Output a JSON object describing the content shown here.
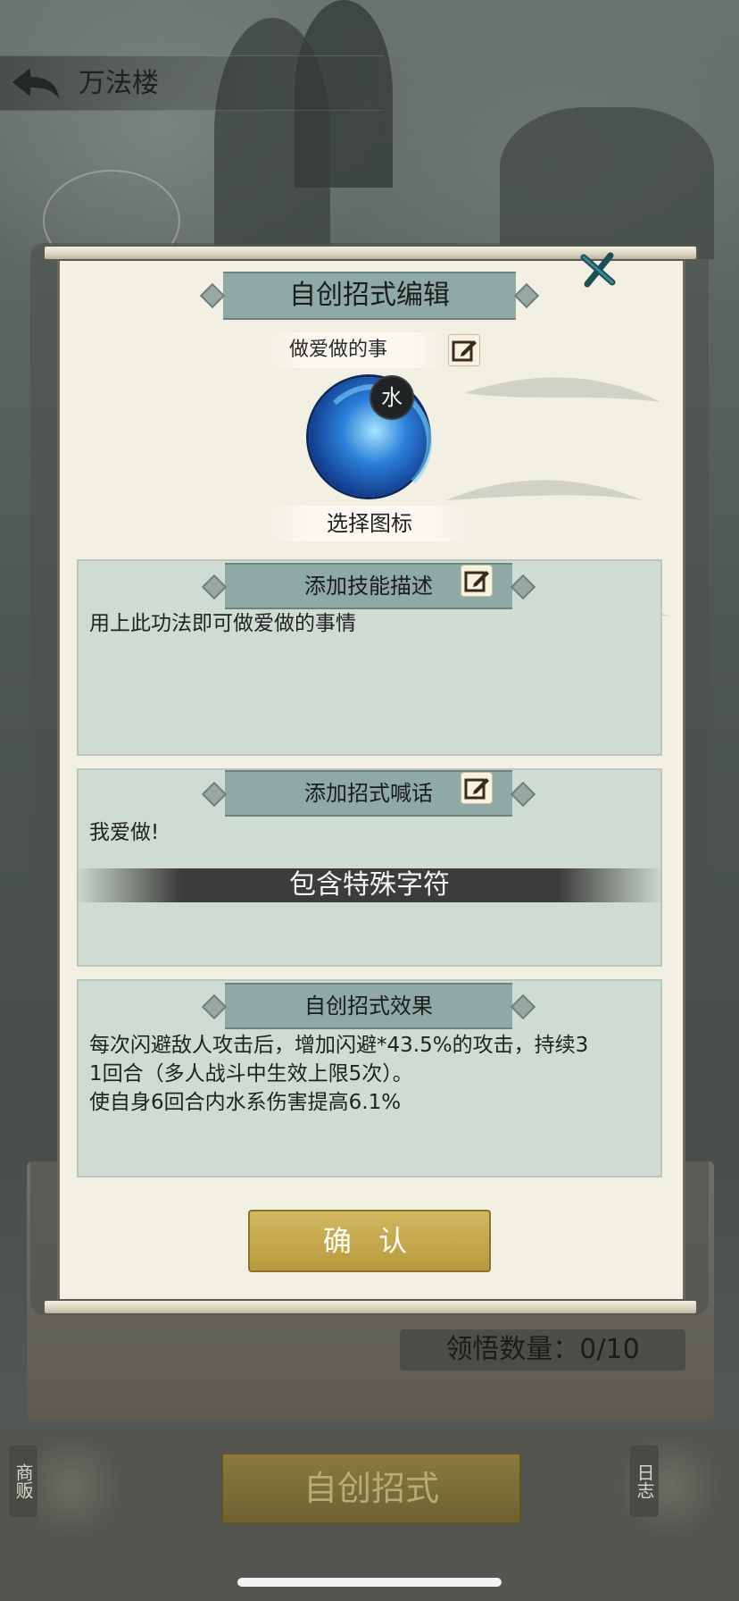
{
  "header": {
    "title": "万法楼"
  },
  "modal": {
    "title": "自创招式编辑",
    "skill_name": "做爱做的事",
    "element_badge": "水",
    "select_icon_label": "选择图标",
    "description": {
      "header": "添加技能描述",
      "text": "用上此功法即可做爱做的事情"
    },
    "shout": {
      "header": "添加招式喊话",
      "text": "我爱做!"
    },
    "toast": "包含特殊字符",
    "effect": {
      "header": "自创招式效果",
      "line1": "每次闪避敌人攻击后，增加闪避*43.5%的攻击，持续3",
      "line2": "1回合（多人战斗中生效上限5次）。",
      "line3": "使自身6回合内水系伤害提高6.1%"
    },
    "confirm_label": "确 认"
  },
  "background": {
    "comprehension_label": "领悟数量：0/10",
    "create_button_label": "自创招式",
    "left_side_label": "商贩",
    "right_side_label": "日志"
  },
  "colors": {
    "paper": "#f2efe3",
    "ribbon": "#8fa9a5",
    "section_bg": "#cfdcd3",
    "confirm_gold": "#c8ab4f",
    "skill_blue": "#2b7fd8"
  }
}
